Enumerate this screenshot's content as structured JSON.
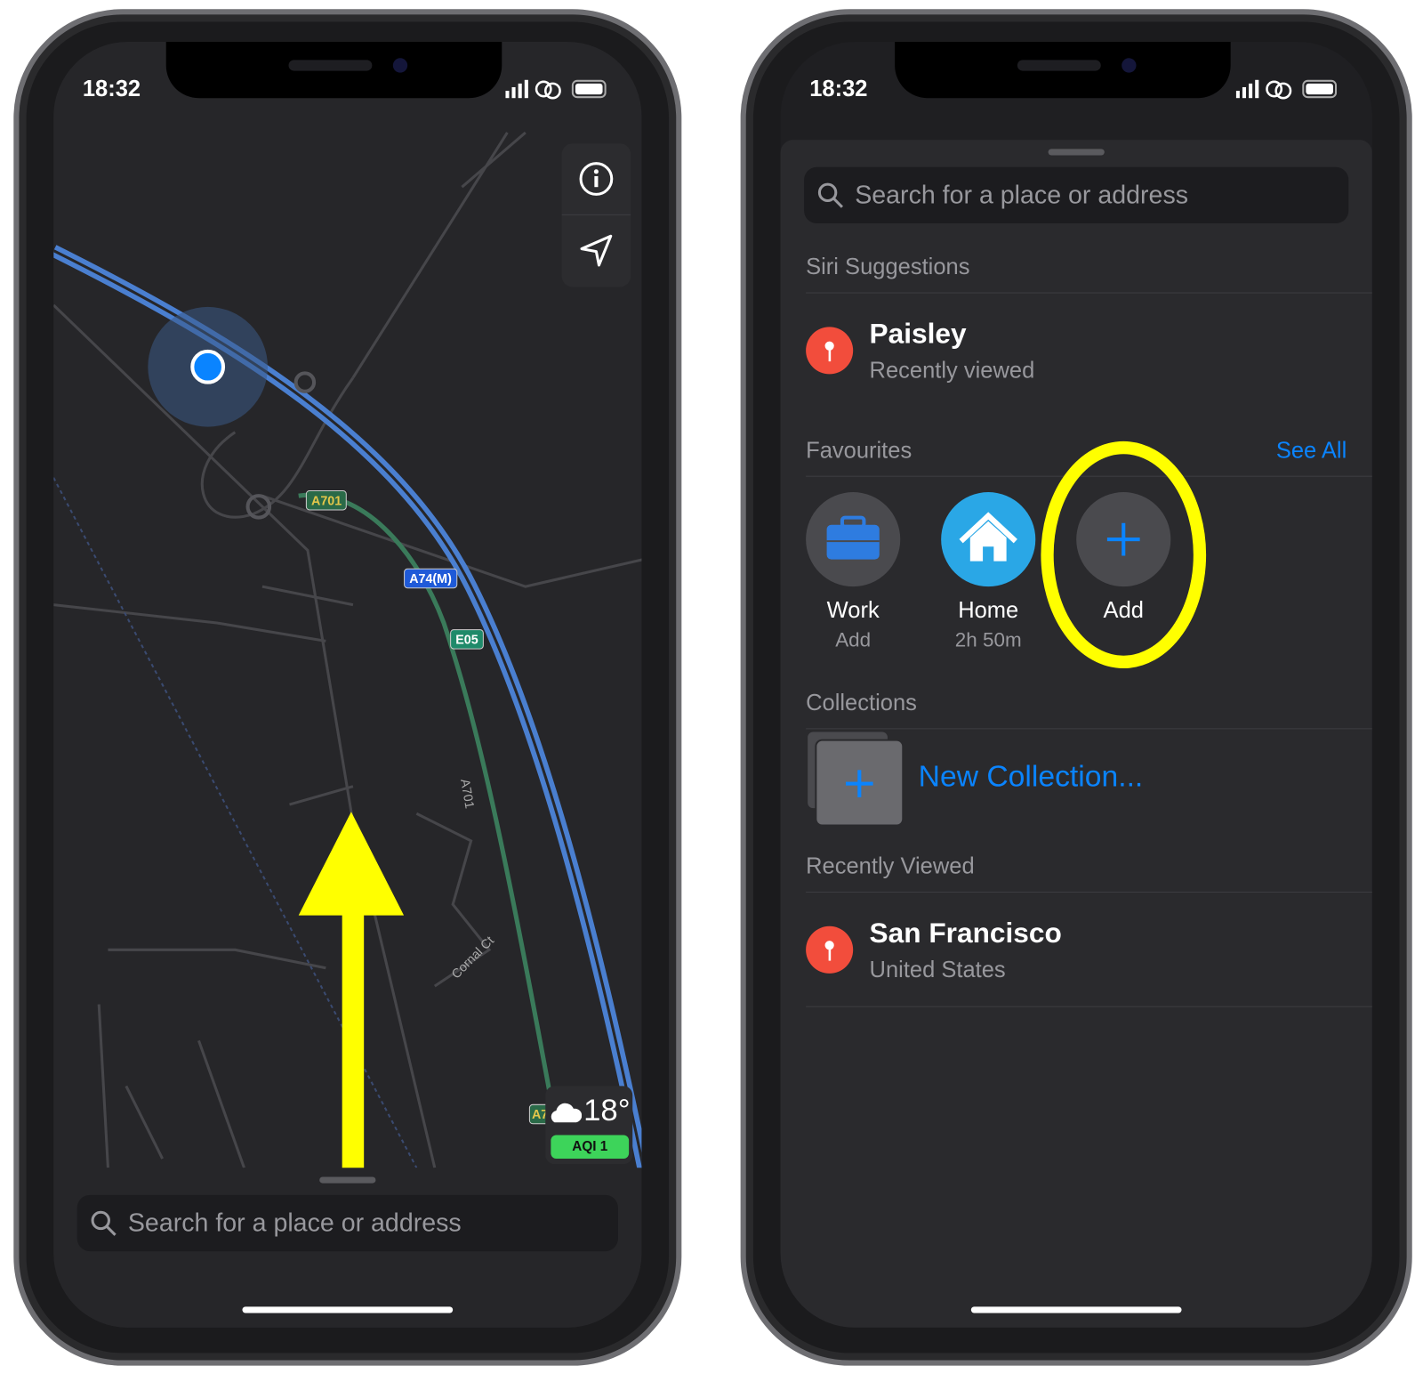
{
  "status": {
    "time": "18:32"
  },
  "left": {
    "map": {
      "road_labels": [
        "A701",
        "A74(M)",
        "E05",
        "A701",
        "Cornal Ct"
      ],
      "partial_label": "A7"
    },
    "weather": {
      "temp": "18°",
      "aqi": "AQI 1",
      "icon": "cloud-icon"
    },
    "controls": {
      "info_icon": "info-icon",
      "location_icon": "location-arrow-icon"
    },
    "search": {
      "placeholder": "Search for a place or address"
    },
    "annotation": {
      "arrow_color": "#ffff00"
    }
  },
  "right": {
    "search": {
      "placeholder": "Search for a place or address"
    },
    "siri": {
      "header": "Siri Suggestions",
      "item": {
        "title": "Paisley",
        "subtitle": "Recently viewed"
      }
    },
    "favourites": {
      "header": "Favourites",
      "see_all": "See All",
      "items": [
        {
          "label": "Work",
          "sub": "Add",
          "icon": "briefcase-icon"
        },
        {
          "label": "Home",
          "sub": "2h 50m",
          "icon": "house-icon"
        },
        {
          "label": "Add",
          "sub": "",
          "icon": "plus-icon"
        }
      ]
    },
    "collections": {
      "header": "Collections",
      "new": "New Collection..."
    },
    "recent": {
      "header": "Recently Viewed",
      "item": {
        "title": "San Francisco",
        "subtitle": "United States"
      }
    },
    "annotation": {
      "circle_color": "#ffff00"
    }
  },
  "colors": {
    "accent": "#0a84ff",
    "pin": "#f24d3c",
    "motorway": "#4a7fd0",
    "aroad": "#3a7a5a",
    "aqi": "#3dd45a"
  }
}
